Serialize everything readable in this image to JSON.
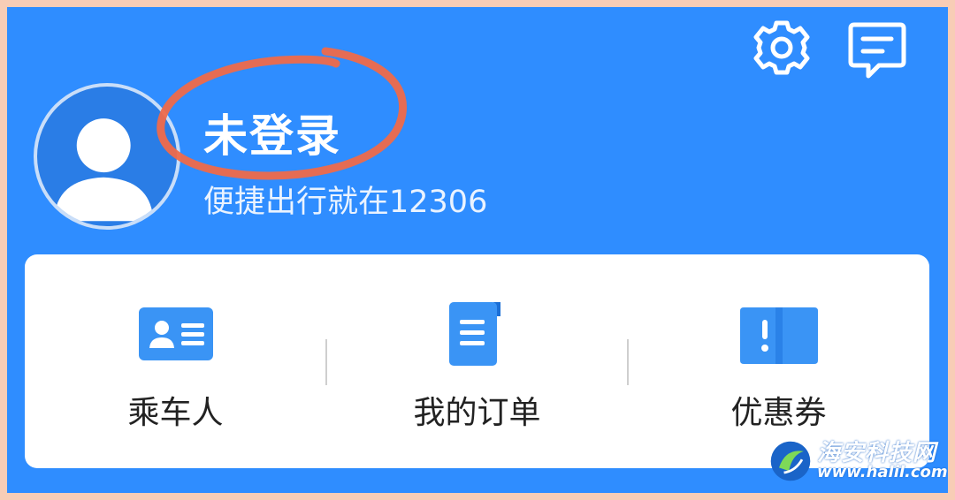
{
  "header": {
    "settings_icon": "gear-icon",
    "message_icon": "message-icon"
  },
  "profile": {
    "login_status": "未登录",
    "slogan": "便捷出行就在12306"
  },
  "quick_actions": [
    {
      "label": "乘车人",
      "icon": "id-card-icon"
    },
    {
      "label": "我的订单",
      "icon": "order-document-icon"
    },
    {
      "label": "优惠券",
      "icon": "ticket-icon"
    }
  ],
  "colors": {
    "header_bg": "#2f8dff",
    "annotation": "#ef6a4a",
    "icon_blue": "#2f8dff"
  },
  "watermark": {
    "line1": "海安科技网",
    "line2": "www.halil.com"
  }
}
